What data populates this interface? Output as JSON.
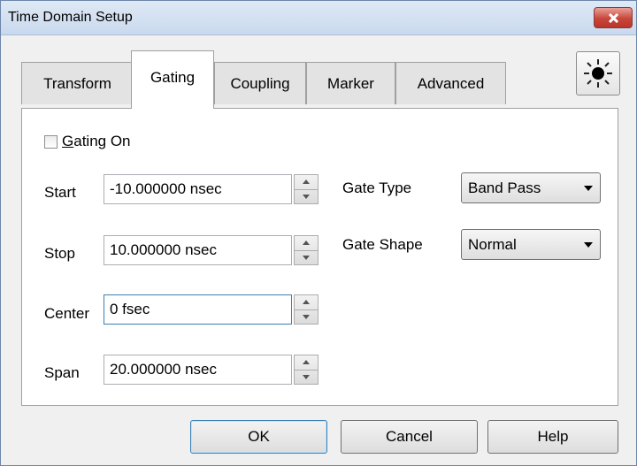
{
  "window": {
    "title": "Time Domain Setup",
    "close_icon": "close-icon"
  },
  "tabs": [
    {
      "label": "Transform",
      "active": false
    },
    {
      "label": "Gating",
      "active": true
    },
    {
      "label": "Coupling",
      "active": false
    },
    {
      "label": "Marker",
      "active": false
    },
    {
      "label": "Advanced",
      "active": false
    }
  ],
  "toolbar": {
    "sun_icon": "sun-icon"
  },
  "gating": {
    "gating_on": {
      "label_mnemonic": "G",
      "label_rest": "ating On",
      "checked": false
    },
    "start": {
      "label": "Start",
      "value": "-10.000000 nsec"
    },
    "stop": {
      "label": "Stop",
      "value": "10.000000 nsec"
    },
    "center": {
      "label": "Center",
      "value": "0 fsec"
    },
    "span": {
      "label": "Span",
      "value": "20.000000 nsec"
    },
    "gate_type": {
      "label": "Gate Type",
      "value": "Band Pass"
    },
    "gate_shape": {
      "label": "Gate Shape",
      "value": "Normal"
    }
  },
  "buttons": {
    "ok": "OK",
    "cancel": "Cancel",
    "help": "Help"
  },
  "colors": {
    "title_bar": "#c9d9ee",
    "close_button": "#c8463a",
    "focus_border": "#3c7fb1"
  }
}
